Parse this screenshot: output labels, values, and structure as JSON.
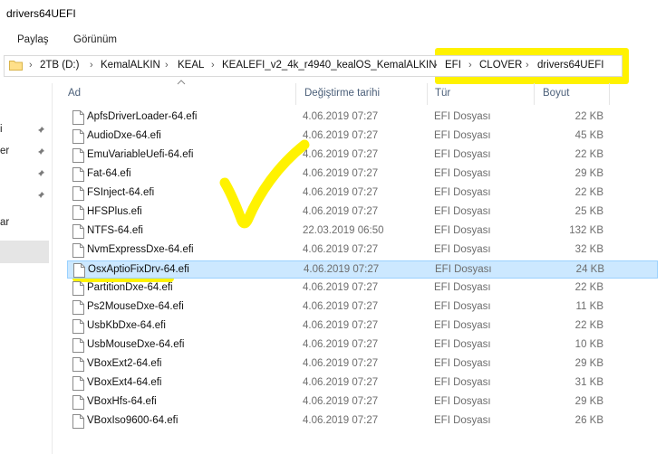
{
  "window": {
    "title": "drivers64UEFI"
  },
  "ribbon": {
    "menus": [
      "Paylaş",
      "Görünüm"
    ]
  },
  "address": {
    "segments": [
      "2TB (D:)",
      "KemalALKIN",
      "KEAL",
      "KEALEFI_v2_4k_r4940_kealOS_KemalALKIN",
      "EFI",
      "CLOVER",
      "drivers64UEFI"
    ]
  },
  "left_pane": {
    "fragments": [
      "i",
      "er",
      "ar"
    ]
  },
  "columns": {
    "name": "Ad",
    "date": "Değiştirme tarihi",
    "type": "Tür",
    "size": "Boyut"
  },
  "files": [
    {
      "name": "ApfsDriverLoader-64.efi",
      "date": "4.06.2019 07:27",
      "type": "EFI Dosyası",
      "size": "22 KB"
    },
    {
      "name": "AudioDxe-64.efi",
      "date": "4.06.2019 07:27",
      "type": "EFI Dosyası",
      "size": "45 KB"
    },
    {
      "name": "EmuVariableUefi-64.efi",
      "date": "4.06.2019 07:27",
      "type": "EFI Dosyası",
      "size": "22 KB"
    },
    {
      "name": "Fat-64.efi",
      "date": "4.06.2019 07:27",
      "type": "EFI Dosyası",
      "size": "29 KB"
    },
    {
      "name": "FSInject-64.efi",
      "date": "4.06.2019 07:27",
      "type": "EFI Dosyası",
      "size": "22 KB"
    },
    {
      "name": "HFSPlus.efi",
      "date": "4.06.2019 07:27",
      "type": "EFI Dosyası",
      "size": "25 KB"
    },
    {
      "name": "NTFS-64.efi",
      "date": "22.03.2019 06:50",
      "type": "EFI Dosyası",
      "size": "132 KB"
    },
    {
      "name": "NvmExpressDxe-64.efi",
      "date": "4.06.2019 07:27",
      "type": "EFI Dosyası",
      "size": "32 KB"
    },
    {
      "name": "OsxAptioFixDrv-64.efi",
      "date": "4.06.2019 07:27",
      "type": "EFI Dosyası",
      "size": "24 KB",
      "selected": true
    },
    {
      "name": "PartitionDxe-64.efi",
      "date": "4.06.2019 07:27",
      "type": "EFI Dosyası",
      "size": "22 KB"
    },
    {
      "name": "Ps2MouseDxe-64.efi",
      "date": "4.06.2019 07:27",
      "type": "EFI Dosyası",
      "size": "11 KB"
    },
    {
      "name": "UsbKbDxe-64.efi",
      "date": "4.06.2019 07:27",
      "type": "EFI Dosyası",
      "size": "22 KB"
    },
    {
      "name": "UsbMouseDxe-64.efi",
      "date": "4.06.2019 07:27",
      "type": "EFI Dosyası",
      "size": "10 KB"
    },
    {
      "name": "VBoxExt2-64.efi",
      "date": "4.06.2019 07:27",
      "type": "EFI Dosyası",
      "size": "29 KB"
    },
    {
      "name": "VBoxExt4-64.efi",
      "date": "4.06.2019 07:27",
      "type": "EFI Dosyası",
      "size": "31 KB"
    },
    {
      "name": "VBoxHfs-64.efi",
      "date": "4.06.2019 07:27",
      "type": "EFI Dosyası",
      "size": "29 KB"
    },
    {
      "name": "VBoxIso9600-64.efi",
      "date": "4.06.2019 07:27",
      "type": "EFI Dosyası",
      "size": "26 KB"
    }
  ],
  "colors": {
    "annotation_highlight": "#fff200",
    "selection_bg": "#cce8ff",
    "selection_border": "#99d1ff",
    "header_text": "#4c607a"
  }
}
